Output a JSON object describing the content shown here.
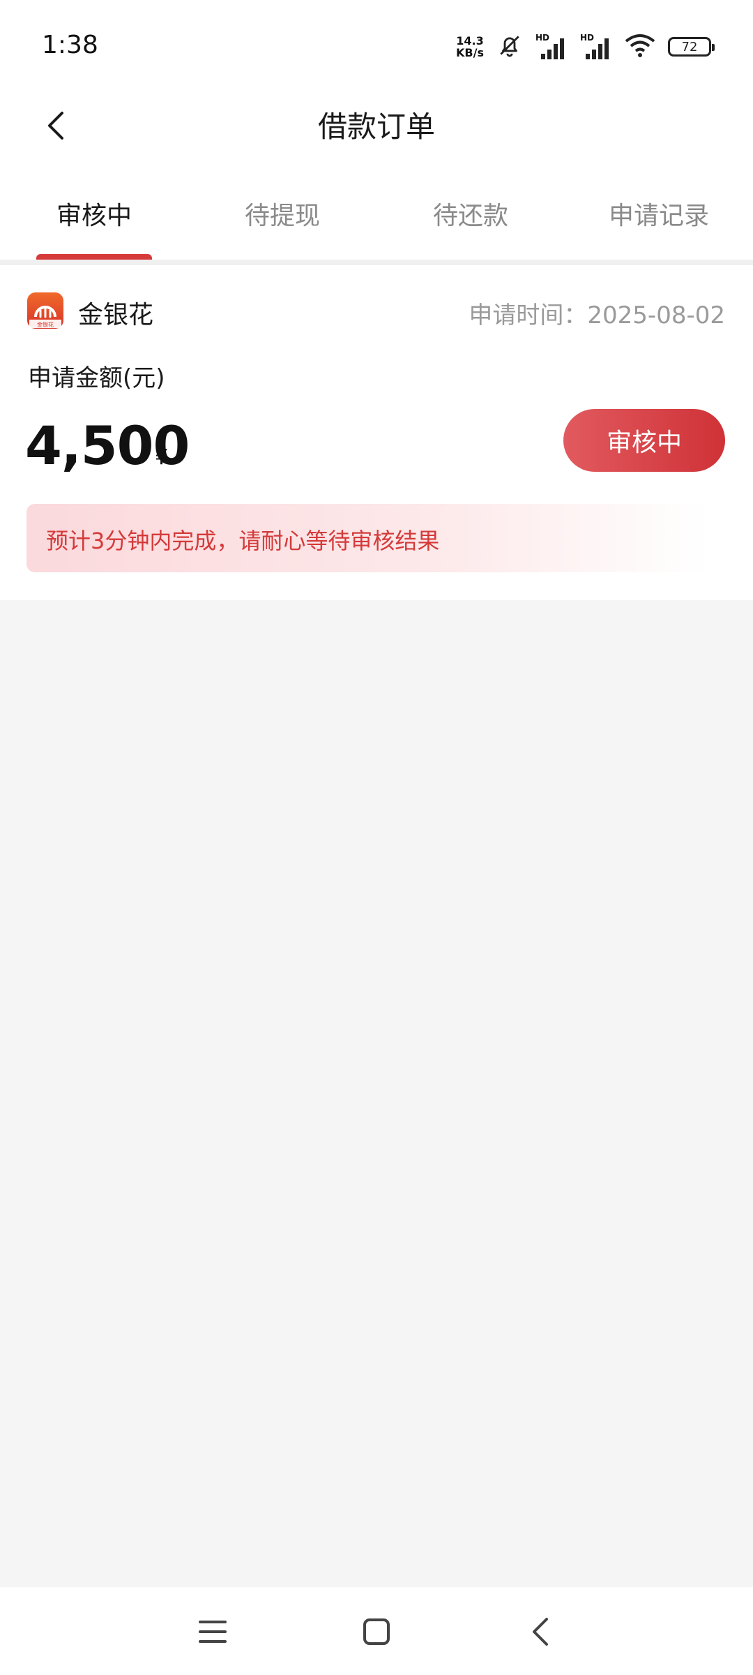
{
  "status_bar": {
    "time": "1:38",
    "net_speed_value": "14.3",
    "net_speed_unit": "KB/s",
    "sim1_label": "HD",
    "sim2_label": "HD",
    "battery": "72",
    "icons": [
      "bell-muted-icon",
      "signal-icon",
      "signal-icon",
      "wifi-icon",
      "battery-icon"
    ]
  },
  "header": {
    "title": "借款订单",
    "back_icon": "chevron-left-icon"
  },
  "tabs": [
    {
      "label": "审核中",
      "active": true
    },
    {
      "label": "待提现",
      "active": false
    },
    {
      "label": "待还款",
      "active": false
    },
    {
      "label": "申请记录",
      "active": false
    }
  ],
  "order": {
    "brand_name": "金银花",
    "logo_text": "金银花",
    "apply_time": "申请时间：2025-08-02",
    "amount_label": "申请金额(元)",
    "amount": "4,500",
    "currency": "¥",
    "status_label": "审核中",
    "notice": "预计3分钟内完成，请耐心等待审核结果"
  },
  "colors": {
    "accent": "#d63b3b",
    "notice_bg": "#fbd9dc",
    "page_bg": "#f5f5f5"
  },
  "nav": {
    "icons": [
      "menu-icon",
      "home-icon",
      "back-icon"
    ]
  }
}
